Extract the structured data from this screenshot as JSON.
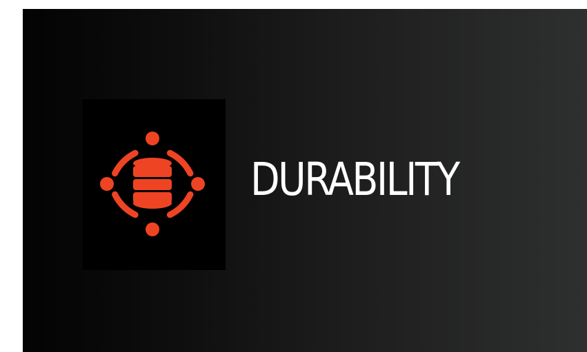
{
  "title": "DURABILITY",
  "icon": "database-cycle-icon",
  "colors": {
    "accent": "#ef4423",
    "text": "#ffffff",
    "background_dark": "#030303",
    "background_light": "#2e2f2f",
    "icon_box": "#000000"
  }
}
